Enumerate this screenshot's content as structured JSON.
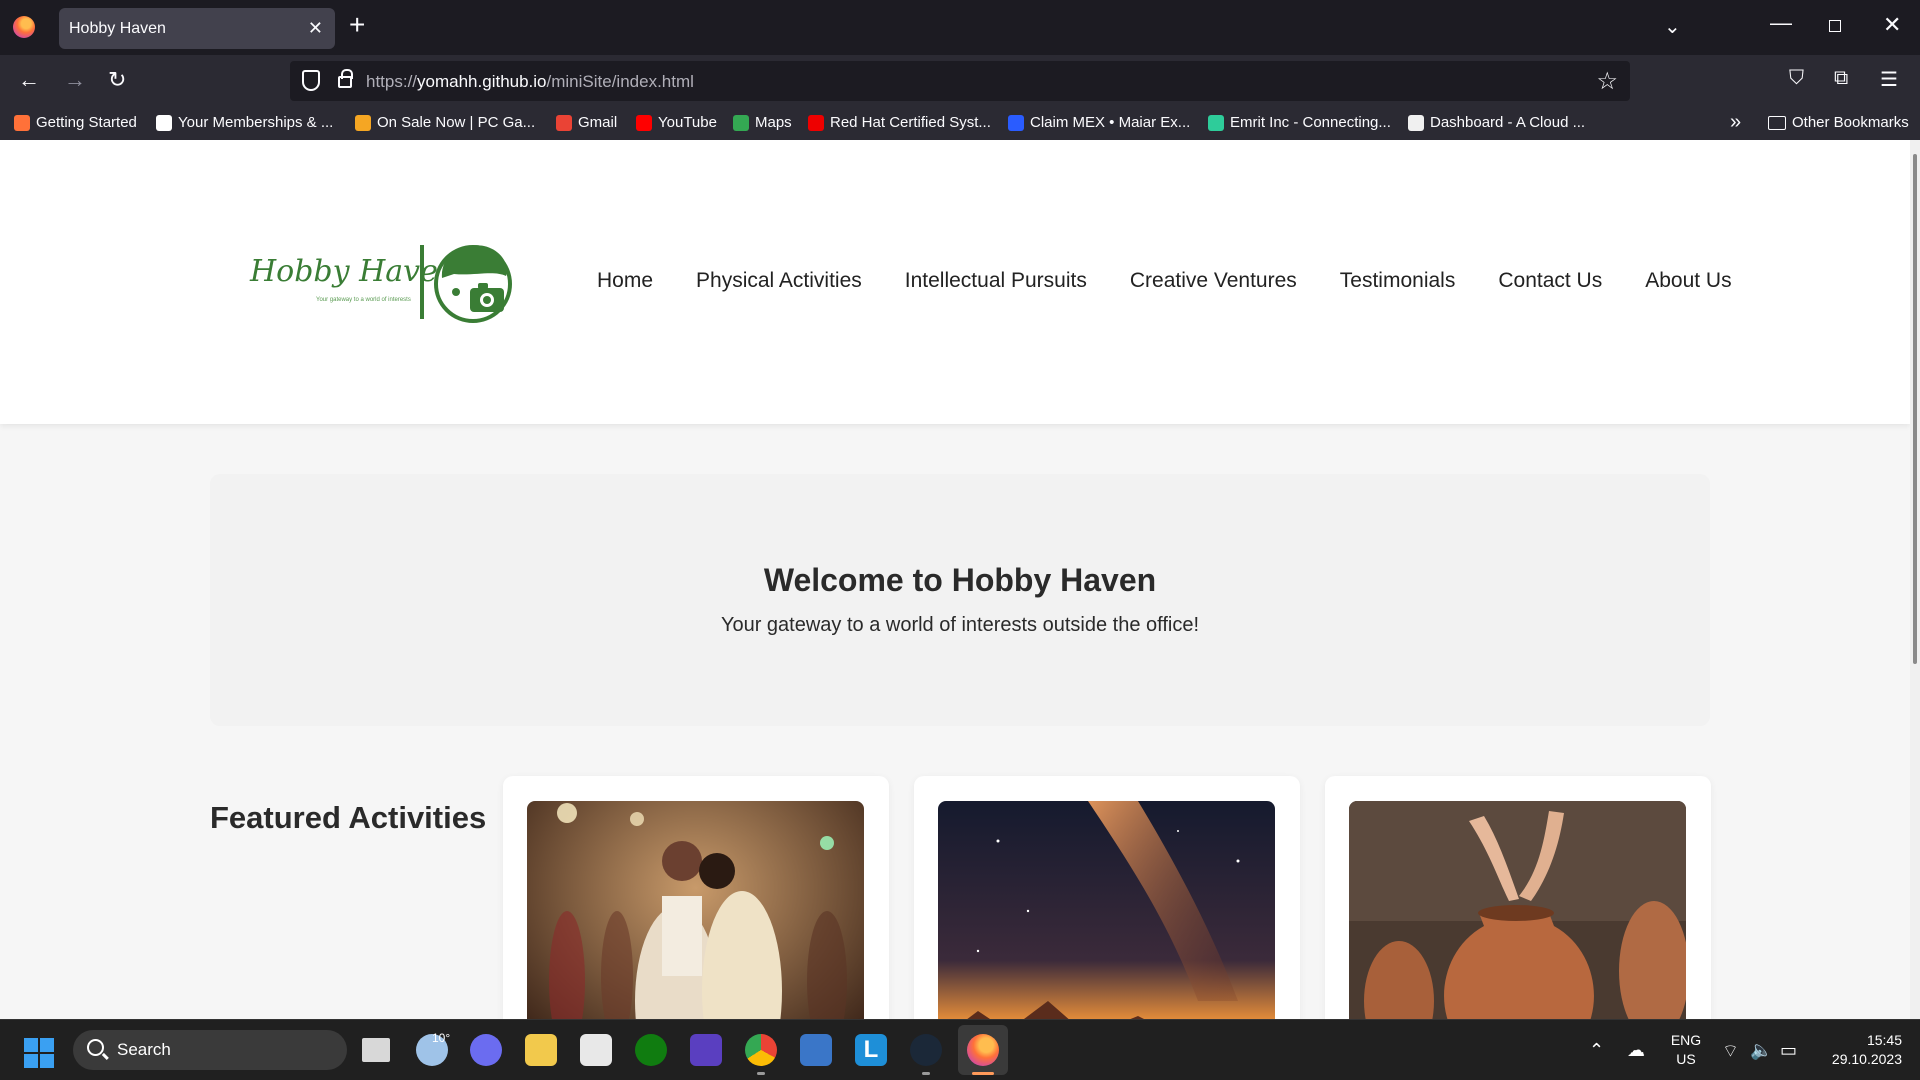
{
  "browser": {
    "tab_title": "Hobby Haven",
    "url_scheme": "https://",
    "url_host": "yomahh.github.io",
    "url_path": "/miniSite/index.html",
    "bookmarks": [
      {
        "label": "Getting Started",
        "icon": "firefox-icon",
        "color": "#ff7139"
      },
      {
        "label": "Your Memberships & ...",
        "icon": "amazon-icon",
        "color": "#ffffff"
      },
      {
        "label": "On Sale Now | PC Ga...",
        "icon": "fanatical-icon",
        "color": "#f5a623"
      },
      {
        "label": "Gmail",
        "icon": "gmail-icon",
        "color": "#ea4335"
      },
      {
        "label": "YouTube",
        "icon": "youtube-icon",
        "color": "#ff0000"
      },
      {
        "label": "Maps",
        "icon": "maps-icon",
        "color": "#34a853"
      },
      {
        "label": "Red Hat Certified Syst...",
        "icon": "redhat-icon",
        "color": "#ee0000"
      },
      {
        "label": "Claim MEX • Maiar Ex...",
        "icon": "maiar-icon",
        "color": "#2a5cff"
      },
      {
        "label": "Emrit Inc - Connecting...",
        "icon": "emrit-icon",
        "color": "#2ecc9a"
      },
      {
        "label": "Dashboard - A Cloud ...",
        "icon": "cloud-icon",
        "color": "#f0f0f0"
      }
    ],
    "other_bookmarks": "Other Bookmarks"
  },
  "site": {
    "logo_text": "Hobby Haven",
    "logo_tagline": "Your gateway to a world of interests",
    "nav": [
      "Home",
      "Physical Activities",
      "Intellectual Pursuits",
      "Creative Ventures",
      "Testimonials",
      "Contact Us",
      "About Us"
    ],
    "hero_title": "Welcome to Hobby Haven",
    "hero_subtitle": "Your gateway to a world of interests outside the office!",
    "featured_title": "Featured Activities",
    "cards": [
      {
        "image": "dancing-couple-photo"
      },
      {
        "image": "night-sky-galaxy-photo"
      },
      {
        "image": "pottery-making-photo"
      }
    ],
    "brand_color": "#3a7d35"
  },
  "taskbar": {
    "search_placeholder": "Search",
    "weather_temp": "10°",
    "lang_line1": "ENG",
    "lang_line2": "US",
    "time": "15:45",
    "date": "29.10.2023"
  }
}
